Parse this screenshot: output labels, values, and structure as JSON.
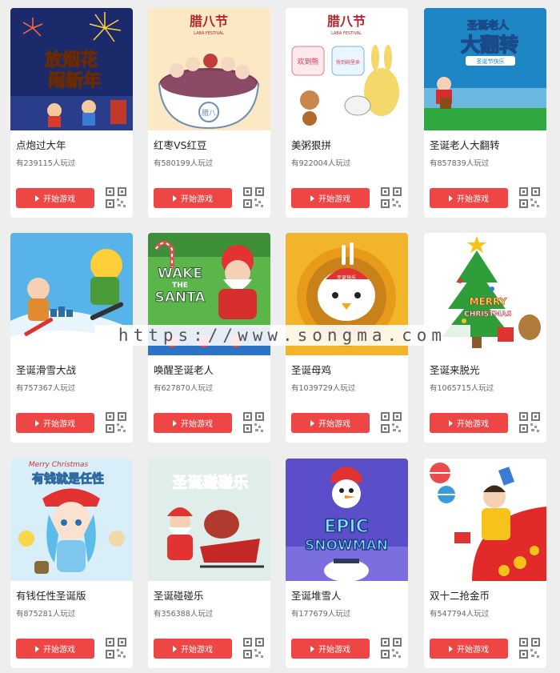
{
  "games": [
    {
      "title": "点炮过大年",
      "plays": "有239115人玩过",
      "button": "开始游戏",
      "thumb_text": [
        "放烟花",
        "闹新年"
      ]
    },
    {
      "title": "红枣VS红豆",
      "plays": "有580199人玩过",
      "button": "开始游戏",
      "thumb_text": [
        "腊八节",
        "LABA FESTIVAL",
        "腊八"
      ]
    },
    {
      "title": "美粥狠拼",
      "plays": "有922004人玩过",
      "button": "开始游戏",
      "thumb_text": [
        "腊八节",
        "LABA FESTIVAL",
        "欢到熊",
        "快到碗里来"
      ]
    },
    {
      "title": "圣诞老人大翻转",
      "plays": "有857839人玩过",
      "button": "开始游戏",
      "thumb_text": [
        "圣诞老人",
        "大翻转",
        "圣诞节快乐"
      ]
    },
    {
      "title": "圣诞滑雪大战",
      "plays": "有757367人玩过",
      "button": "开始游戏",
      "thumb_text": []
    },
    {
      "title": "唤醒圣诞老人",
      "plays": "有627870人玩过",
      "button": "开始游戏",
      "thumb_text": [
        "WAKE",
        "THE",
        "SANTA"
      ]
    },
    {
      "title": "圣诞母鸡",
      "plays": "有1039729人玩过",
      "button": "开始游戏",
      "thumb_text": [
        "圣诞快乐"
      ]
    },
    {
      "title": "圣诞来脱光",
      "plays": "有1065715人玩过",
      "button": "开始游戏",
      "thumb_text": [
        "MERRY",
        "CHRISTMAS"
      ]
    },
    {
      "title": "有钱任性圣诞版",
      "plays": "有875281人玩过",
      "button": "开始游戏",
      "thumb_text": [
        "Merry Christmas",
        "有钱就是任性"
      ]
    },
    {
      "title": "圣诞碰碰乐",
      "plays": "有356388人玩过",
      "button": "开始游戏",
      "thumb_text": [
        "圣诞碰碰乐"
      ]
    },
    {
      "title": "圣诞堆雪人",
      "plays": "有177679人玩过",
      "button": "开始游戏",
      "thumb_text": [
        "EPIC",
        "SNOWMAN"
      ]
    },
    {
      "title": "双十二抢金币",
      "plays": "有547794人玩过",
      "button": "开始游戏",
      "thumb_text": []
    }
  ],
  "watermark": "https://www.songma.com",
  "colors": {
    "button": "#ee4545",
    "page_bg": "#eeeeee",
    "card_bg": "#ffffff"
  },
  "icons": {
    "play": "play-triangle-icon",
    "qr": "qr-code-icon"
  }
}
